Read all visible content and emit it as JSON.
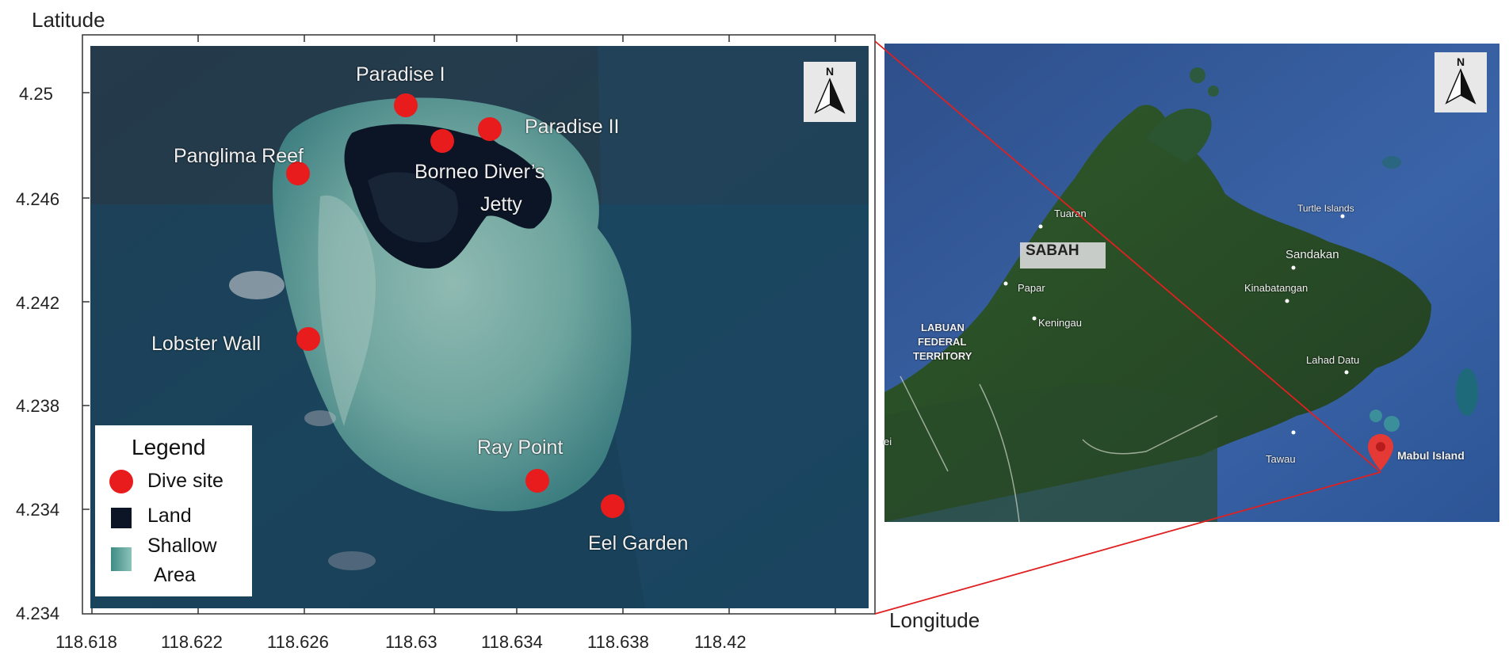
{
  "axes": {
    "y_title": "Latitude",
    "x_title": "Longitude",
    "y_ticks": [
      "4.25",
      "4.246",
      "4.242",
      "4.238",
      "4.234",
      "4.234"
    ],
    "x_ticks": [
      "118.618",
      "118.622",
      "118.626",
      "118.63",
      "118.634",
      "118.638",
      "118.42"
    ]
  },
  "map_left": {
    "dive_sites": [
      {
        "label": "Paradise I"
      },
      {
        "label": "Paradise II"
      },
      {
        "label": "Borneo Diver’s"
      },
      {
        "label": "Jetty"
      },
      {
        "label": "Panglima Reef"
      },
      {
        "label": "Lobster Wall"
      },
      {
        "label": "Ray Point"
      },
      {
        "label": "Eel Garden"
      }
    ],
    "north_arrow": "N"
  },
  "legend": {
    "title": "Legend",
    "items": [
      {
        "label": "Dive site"
      },
      {
        "label": "Land"
      },
      {
        "label": "Shallow"
      },
      {
        "label": "Area"
      }
    ]
  },
  "map_right": {
    "region_label": "SABAH",
    "places": [
      "Tuaran",
      "Papar",
      "Keningau",
      "LABUAN",
      "FEDERAL",
      "TERRITORY",
      "Sandakan",
      "Kinabatangan",
      "Turtle Islands",
      "Lahad Datu",
      "Tawau",
      "Mabul Island",
      "ei"
    ],
    "north_arrow": "N"
  },
  "colors": {
    "dive_site": "#e81c1c",
    "land": "#0c1526",
    "shallow": "#5fa59c",
    "inset_line": "#e02020"
  }
}
